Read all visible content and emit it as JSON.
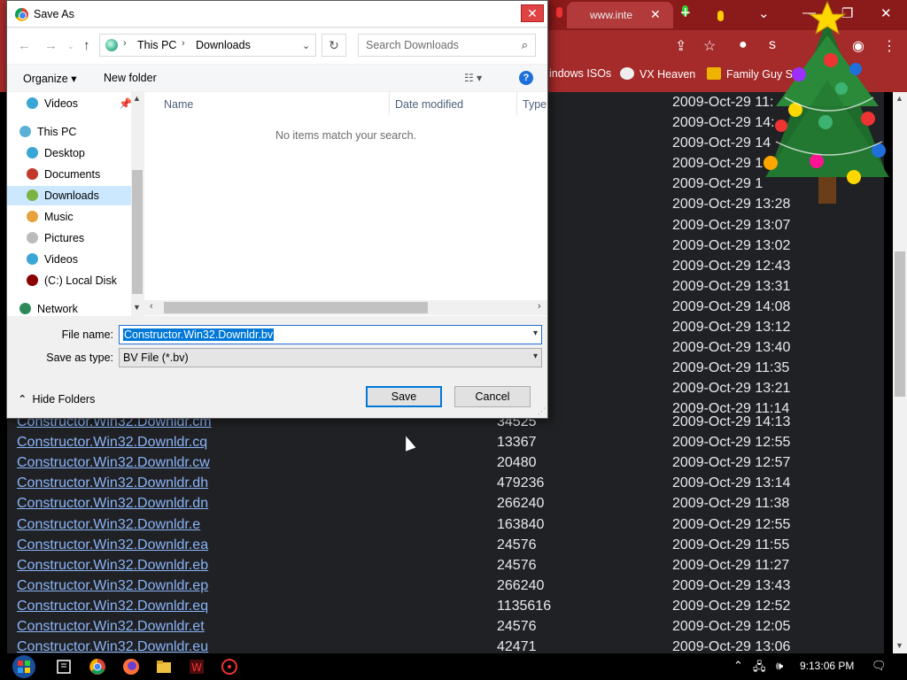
{
  "browser": {
    "tab_title": "www.inte",
    "bookmarks": [
      "indows ISOs",
      "VX Heaven",
      "Family Guy S"
    ]
  },
  "page": {
    "dates_above_dialog": [
      "2009-Oct-29 11:",
      "2009-Oct-29 14:",
      "2009-Oct-29 14",
      "2009-Oct-29 1",
      "2009-Oct-29 1",
      "2009-Oct-29 13:28",
      "2009-Oct-29 13:07",
      "2009-Oct-29 13:02",
      "2009-Oct-29 12:43",
      "2009-Oct-29 13:31",
      "2009-Oct-29 14:08",
      "2009-Oct-29 13:12",
      "2009-Oct-29 13:40",
      "2009-Oct-29 11:35",
      "2009-Oct-29 13:21",
      "2009-Oct-29 11:14"
    ],
    "files": [
      {
        "name": "Constructor.Win32.Downldr.cm",
        "size": "34525",
        "date": "2009-Oct-29 14:13"
      },
      {
        "name": "Constructor.Win32.Downldr.cq",
        "size": "13367",
        "date": "2009-Oct-29 12:55"
      },
      {
        "name": "Constructor.Win32.Downldr.cw",
        "size": "20480",
        "date": "2009-Oct-29 12:57"
      },
      {
        "name": "Constructor.Win32.Downldr.dh",
        "size": "479236",
        "date": "2009-Oct-29 13:14"
      },
      {
        "name": "Constructor.Win32.Downldr.dn",
        "size": "266240",
        "date": "2009-Oct-29 11:38"
      },
      {
        "name": "Constructor.Win32.Downldr.e",
        "size": "163840",
        "date": "2009-Oct-29 12:55"
      },
      {
        "name": "Constructor.Win32.Downldr.ea",
        "size": "24576",
        "date": "2009-Oct-29 11:55"
      },
      {
        "name": "Constructor.Win32.Downldr.eb",
        "size": "24576",
        "date": "2009-Oct-29 11:27"
      },
      {
        "name": "Constructor.Win32.Downldr.ep",
        "size": "266240",
        "date": "2009-Oct-29 13:43"
      },
      {
        "name": "Constructor.Win32.Downldr.eq",
        "size": "1135616",
        "date": "2009-Oct-29 12:52"
      },
      {
        "name": "Constructor.Win32.Downldr.et",
        "size": "24576",
        "date": "2009-Oct-29 12:05"
      },
      {
        "name": "Constructor.Win32.Downldr.eu",
        "size": "42471",
        "date": "2009-Oct-29 13:06"
      }
    ]
  },
  "dialog": {
    "title": "Save As",
    "close_glyph": "✕",
    "breadcrumb": [
      "This PC",
      "Downloads"
    ],
    "breadcrumb_sep": "›",
    "search_placeholder": "Search Downloads",
    "organize_label": "Organize ▾",
    "new_folder_label": "New folder",
    "nav_items": [
      {
        "label": "Videos",
        "color": "#3aa6d6"
      },
      {
        "label": "This PC",
        "color": "#5bb0d8"
      },
      {
        "label": "Desktop",
        "color": "#3aa6d6"
      },
      {
        "label": "Documents",
        "color": "#c0392b"
      },
      {
        "label": "Downloads",
        "color": "#7cb342"
      },
      {
        "label": "Music",
        "color": "#e6a23c"
      },
      {
        "label": "Pictures",
        "color": "#bbbbbb"
      },
      {
        "label": "Videos",
        "color": "#3aa6d6"
      },
      {
        "label": "(C:) Local Disk",
        "color": "#8b0000"
      },
      {
        "label": "Network",
        "color": "#2e8b57"
      }
    ],
    "columns": [
      "Name",
      "Date modified",
      "Type"
    ],
    "empty_message": "No items match your search.",
    "file_name_label": "File name:",
    "file_name_value": "Constructor.Win32.Downldr.bv",
    "save_type_label": "Save as type:",
    "save_type_value": "BV File (*.bv)",
    "hide_folders_label": "Hide Folders",
    "save_label": "Save",
    "cancel_label": "Cancel"
  },
  "taskbar": {
    "clock": "9:13:06 PM"
  },
  "colors": {
    "chrome_frame": "#a52a2a",
    "page_bg": "#202124",
    "link": "#8ab4f8",
    "selection": "#0078d7"
  }
}
